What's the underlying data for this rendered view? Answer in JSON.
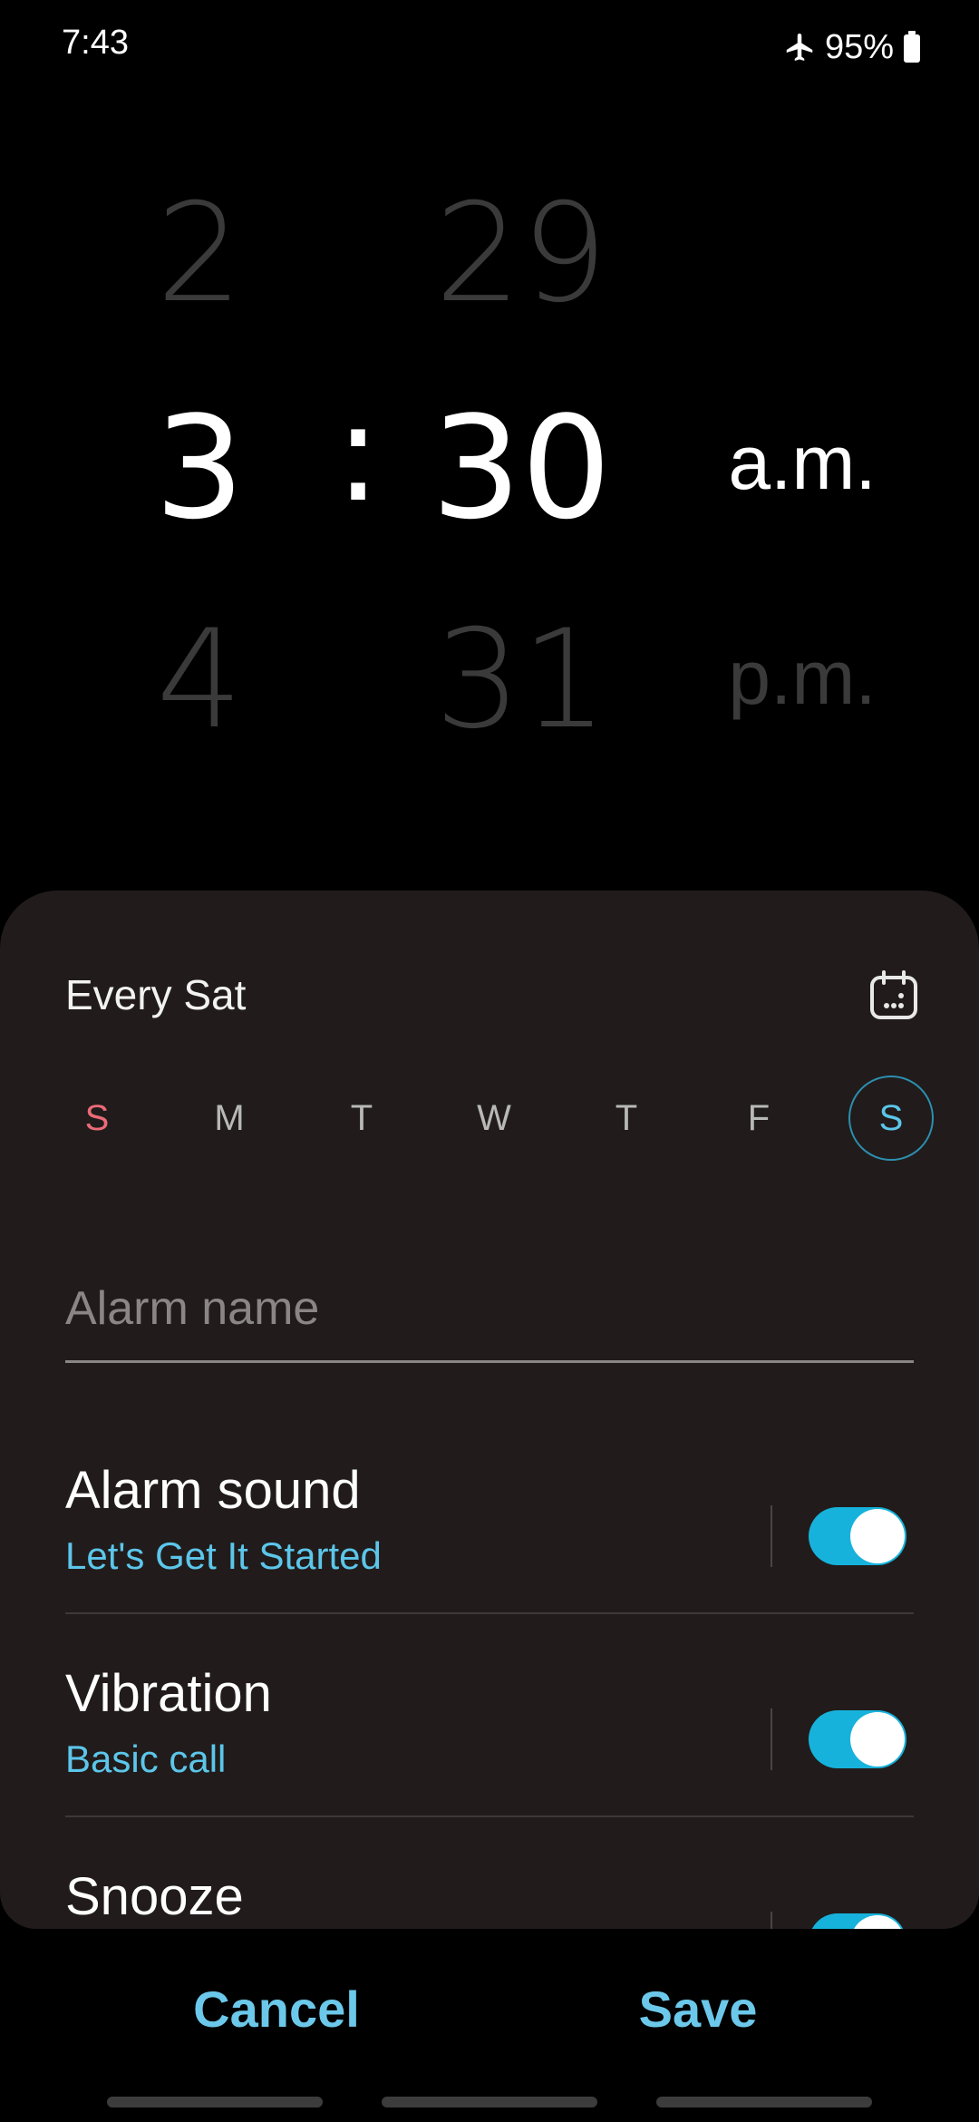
{
  "status_bar": {
    "time": "7:43",
    "battery": "95%",
    "icons": [
      "airplane-icon",
      "battery-icon"
    ]
  },
  "time_picker": {
    "hour_prev": "2",
    "hour": "3",
    "hour_next": "4",
    "separator": ":",
    "minute_prev": "29",
    "minute": "30",
    "minute_next": "31",
    "period": "a.m.",
    "period_alt": "p.m."
  },
  "repeat": {
    "label": "Every Sat",
    "calendar_icon": "calendar-icon",
    "days": [
      "S",
      "M",
      "T",
      "W",
      "T",
      "F",
      "S"
    ],
    "selected_day_index": 6
  },
  "alarm_name": {
    "placeholder": "Alarm name",
    "value": ""
  },
  "settings": {
    "alarm_sound": {
      "title": "Alarm sound",
      "value": "Let's Get It Started",
      "enabled": true
    },
    "vibration": {
      "title": "Vibration",
      "value": "Basic call",
      "enabled": true
    },
    "snooze": {
      "title": "Snooze",
      "enabled": true
    }
  },
  "actions": {
    "cancel": "Cancel",
    "save": "Save"
  },
  "colors": {
    "accent": "#5cc6ea",
    "toggle_on": "#17b2dc",
    "sunday": "#ec6b79",
    "sheet_bg": "#211c1b"
  }
}
